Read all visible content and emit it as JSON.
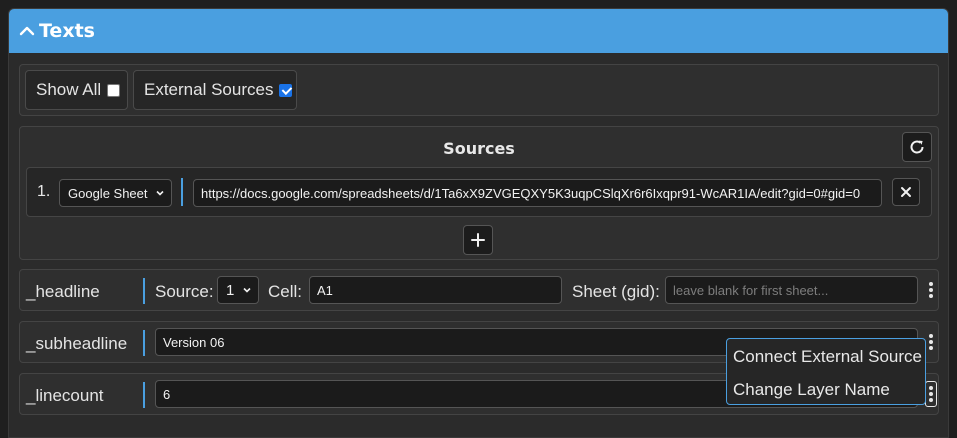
{
  "panel": {
    "title": "Texts"
  },
  "toggles": {
    "show_all": {
      "label": "Show All",
      "checked": false
    },
    "external_sources": {
      "label": "External Sources",
      "checked": true
    }
  },
  "sources": {
    "title": "Sources",
    "items": [
      {
        "number": "1.",
        "type": "Google Sheet",
        "url": "https://docs.google.com/spreadsheets/d/1Ta6xX9ZVGEQXY5K3uqpCSlqXr6r6Ixqpr91-WcAR1IA/edit?gid=0#gid=0"
      }
    ]
  },
  "layers": [
    {
      "name": "_headline",
      "source_label": "Source:",
      "source_value": "1",
      "cell_label": "Cell:",
      "cell_value": "A1",
      "sheet_label": "Sheet (gid):",
      "sheet_placeholder": "leave blank for first sheet..."
    },
    {
      "name": "_subheadline",
      "value": "Version 06"
    },
    {
      "name": "_linecount",
      "value": "6"
    }
  ],
  "context_menu": {
    "items": [
      "Connect External Source",
      "Change Layer Name"
    ]
  },
  "colors": {
    "accent": "#4a9fe0",
    "checkbox_checked": "#1a73e8",
    "background": "#1f1f1f"
  },
  "icons": [
    "chevron-up-icon",
    "refresh-icon",
    "close-icon",
    "plus-icon",
    "kebab-menu-icon",
    "dropdown-arrow-icon"
  ]
}
